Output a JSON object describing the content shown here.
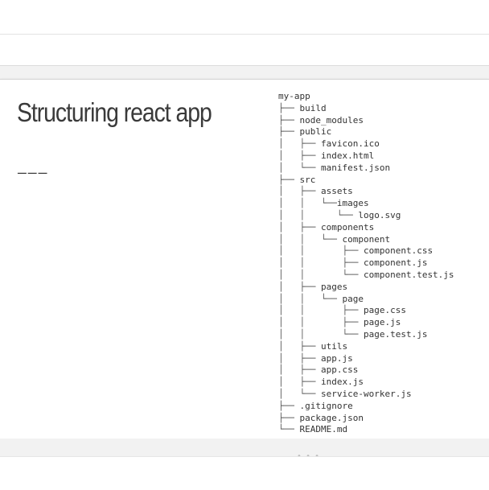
{
  "slide": {
    "title": "Structuring react app",
    "divider": "———",
    "tree": [
      {
        "prefix": "",
        "name": "my-app"
      },
      {
        "prefix": "├── ",
        "name": "build"
      },
      {
        "prefix": "├── ",
        "name": "node_modules"
      },
      {
        "prefix": "├── ",
        "name": "public"
      },
      {
        "prefix": "│   ├── ",
        "name": "favicon.ico"
      },
      {
        "prefix": "│   ├── ",
        "name": "index.html"
      },
      {
        "prefix": "│   └── ",
        "name": "manifest.json"
      },
      {
        "prefix": "├── ",
        "name": "src"
      },
      {
        "prefix": "│   ├── ",
        "name": "assets"
      },
      {
        "prefix": "│   │   └──",
        "name": "images"
      },
      {
        "prefix": "│   │      └── ",
        "name": "logo.svg"
      },
      {
        "prefix": "│   ├── ",
        "name": "components"
      },
      {
        "prefix": "│   │   └── ",
        "name": "component"
      },
      {
        "prefix": "│   │       ├── ",
        "name": "component.css"
      },
      {
        "prefix": "│   │       ├── ",
        "name": "component.js"
      },
      {
        "prefix": "│   │       └── ",
        "name": "component.test.js"
      },
      {
        "prefix": "│   ├── ",
        "name": "pages"
      },
      {
        "prefix": "│   │   └── ",
        "name": "page"
      },
      {
        "prefix": "│   │       ├── ",
        "name": "page.css"
      },
      {
        "prefix": "│   │       ├── ",
        "name": "page.js"
      },
      {
        "prefix": "│   │       └── ",
        "name": "page.test.js"
      },
      {
        "prefix": "│   ├── ",
        "name": "utils"
      },
      {
        "prefix": "│   ├── ",
        "name": "app.js"
      },
      {
        "prefix": "│   ├── ",
        "name": "app.css"
      },
      {
        "prefix": "│   ├── ",
        "name": "index.js"
      },
      {
        "prefix": "│   └── ",
        "name": "service-worker.js"
      },
      {
        "prefix": "├── ",
        "name": ".gitignore"
      },
      {
        "prefix": "├── ",
        "name": "package.json"
      },
      {
        "prefix": "└── ",
        "name": "README.md"
      }
    ]
  },
  "resize_handle": "• • •",
  "icons": {
    "resize_handle": "drag-handle-icon"
  },
  "colors": {
    "text": "#333333",
    "title": "#3a3a3a",
    "background": "#ffffff",
    "gutter": "#f2f2f2"
  }
}
